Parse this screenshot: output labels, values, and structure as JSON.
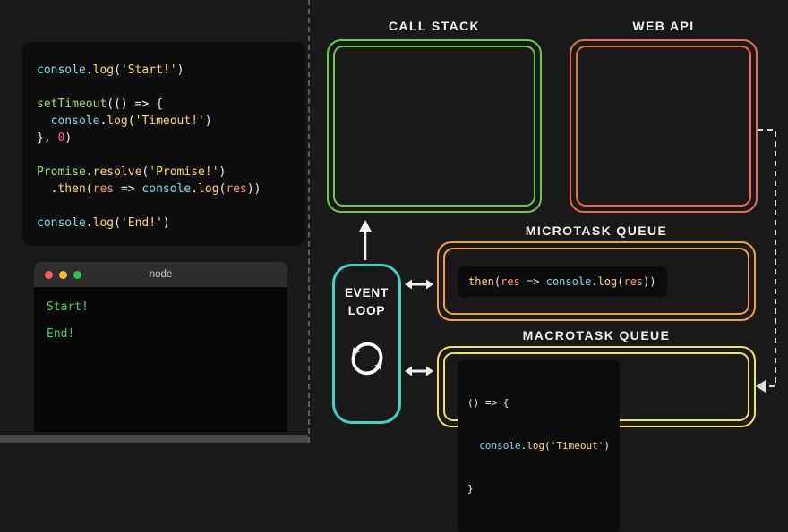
{
  "palette": {
    "cyan": "#78dce8",
    "yellow": "#ffd866",
    "green": "#a9dc76",
    "orange": "#fc9867",
    "pink": "#ff6188",
    "white": "#f2f2f0"
  },
  "colors": {
    "background": "#191919",
    "call_stack_border": "#6ecb3f",
    "web_api_border": "#ed6a4d",
    "microtask_border": "#f3a42c",
    "macrotask_border": "#f8e14b",
    "event_loop_border": "#35d8c7",
    "terminal_output_text": "#3ddc5c",
    "arrow": "#eeeeee"
  },
  "left": {
    "code_panel": {
      "lines": [
        [
          {
            "t": "console",
            "c": "cyan"
          },
          {
            "t": ".",
            "c": "white"
          },
          {
            "t": "log",
            "c": "yellow"
          },
          {
            "t": "(",
            "c": "white"
          },
          {
            "t": "'Start!'",
            "c": "yellow"
          },
          {
            "t": ")",
            "c": "white"
          }
        ],
        [],
        [
          {
            "t": "setTimeout",
            "c": "green"
          },
          {
            "t": "(() => {",
            "c": "white"
          }
        ],
        [
          {
            "t": "  ",
            "c": "white"
          },
          {
            "t": "console",
            "c": "cyan"
          },
          {
            "t": ".",
            "c": "white"
          },
          {
            "t": "log",
            "c": "yellow"
          },
          {
            "t": "(",
            "c": "white"
          },
          {
            "t": "'Timeout!'",
            "c": "yellow"
          },
          {
            "t": ")",
            "c": "white"
          }
        ],
        [
          {
            "t": "}, ",
            "c": "white"
          },
          {
            "t": "0",
            "c": "pink"
          },
          {
            "t": ")",
            "c": "white"
          }
        ],
        [],
        [
          {
            "t": "Promise",
            "c": "green"
          },
          {
            "t": ".",
            "c": "white"
          },
          {
            "t": "resolve",
            "c": "yellow"
          },
          {
            "t": "(",
            "c": "white"
          },
          {
            "t": "'Promise!'",
            "c": "yellow"
          },
          {
            "t": ")",
            "c": "white"
          }
        ],
        [
          {
            "t": "  .",
            "c": "white"
          },
          {
            "t": "then",
            "c": "yellow"
          },
          {
            "t": "(",
            "c": "white"
          },
          {
            "t": "res",
            "c": "orange"
          },
          {
            "t": " => ",
            "c": "white"
          },
          {
            "t": "console",
            "c": "cyan"
          },
          {
            "t": ".",
            "c": "white"
          },
          {
            "t": "log",
            "c": "yellow"
          },
          {
            "t": "(",
            "c": "white"
          },
          {
            "t": "res",
            "c": "orange"
          },
          {
            "t": "))",
            "c": "white"
          }
        ],
        [],
        [
          {
            "t": "console",
            "c": "cyan"
          },
          {
            "t": ".",
            "c": "white"
          },
          {
            "t": "log",
            "c": "yellow"
          },
          {
            "t": "(",
            "c": "white"
          },
          {
            "t": "'End!'",
            "c": "yellow"
          },
          {
            "t": ")",
            "c": "white"
          }
        ]
      ]
    },
    "terminal": {
      "title": "node",
      "output": [
        "Start!",
        "End!"
      ]
    }
  },
  "right": {
    "call_stack": {
      "label": "CALL STACK"
    },
    "web_api": {
      "label": "WEB API"
    },
    "microtask_queue": {
      "label": "MICROTASK QUEUE",
      "code_tokens": [
        {
          "t": "then",
          "c": "yellow"
        },
        {
          "t": "(",
          "c": "white"
        },
        {
          "t": "res",
          "c": "orange"
        },
        {
          "t": " => ",
          "c": "white"
        },
        {
          "t": "console",
          "c": "cyan"
        },
        {
          "t": ".",
          "c": "white"
        },
        {
          "t": "log",
          "c": "yellow"
        },
        {
          "t": "(",
          "c": "white"
        },
        {
          "t": "res",
          "c": "orange"
        },
        {
          "t": "))",
          "c": "white"
        }
      ]
    },
    "macrotask_queue": {
      "label": "MACROTASK QUEUE",
      "code_lines": [
        [
          {
            "t": "() => {",
            "c": "white"
          }
        ],
        [
          {
            "t": "  ",
            "c": "white"
          },
          {
            "t": "console",
            "c": "cyan"
          },
          {
            "t": ".",
            "c": "white"
          },
          {
            "t": "log",
            "c": "yellow"
          },
          {
            "t": "(",
            "c": "white"
          },
          {
            "t": "'Timeout'",
            "c": "yellow"
          },
          {
            "t": ")",
            "c": "white"
          }
        ],
        [
          {
            "t": "}",
            "c": "white"
          }
        ]
      ]
    },
    "event_loop": {
      "label_top": "EVENT",
      "label_bottom": "LOOP"
    }
  }
}
